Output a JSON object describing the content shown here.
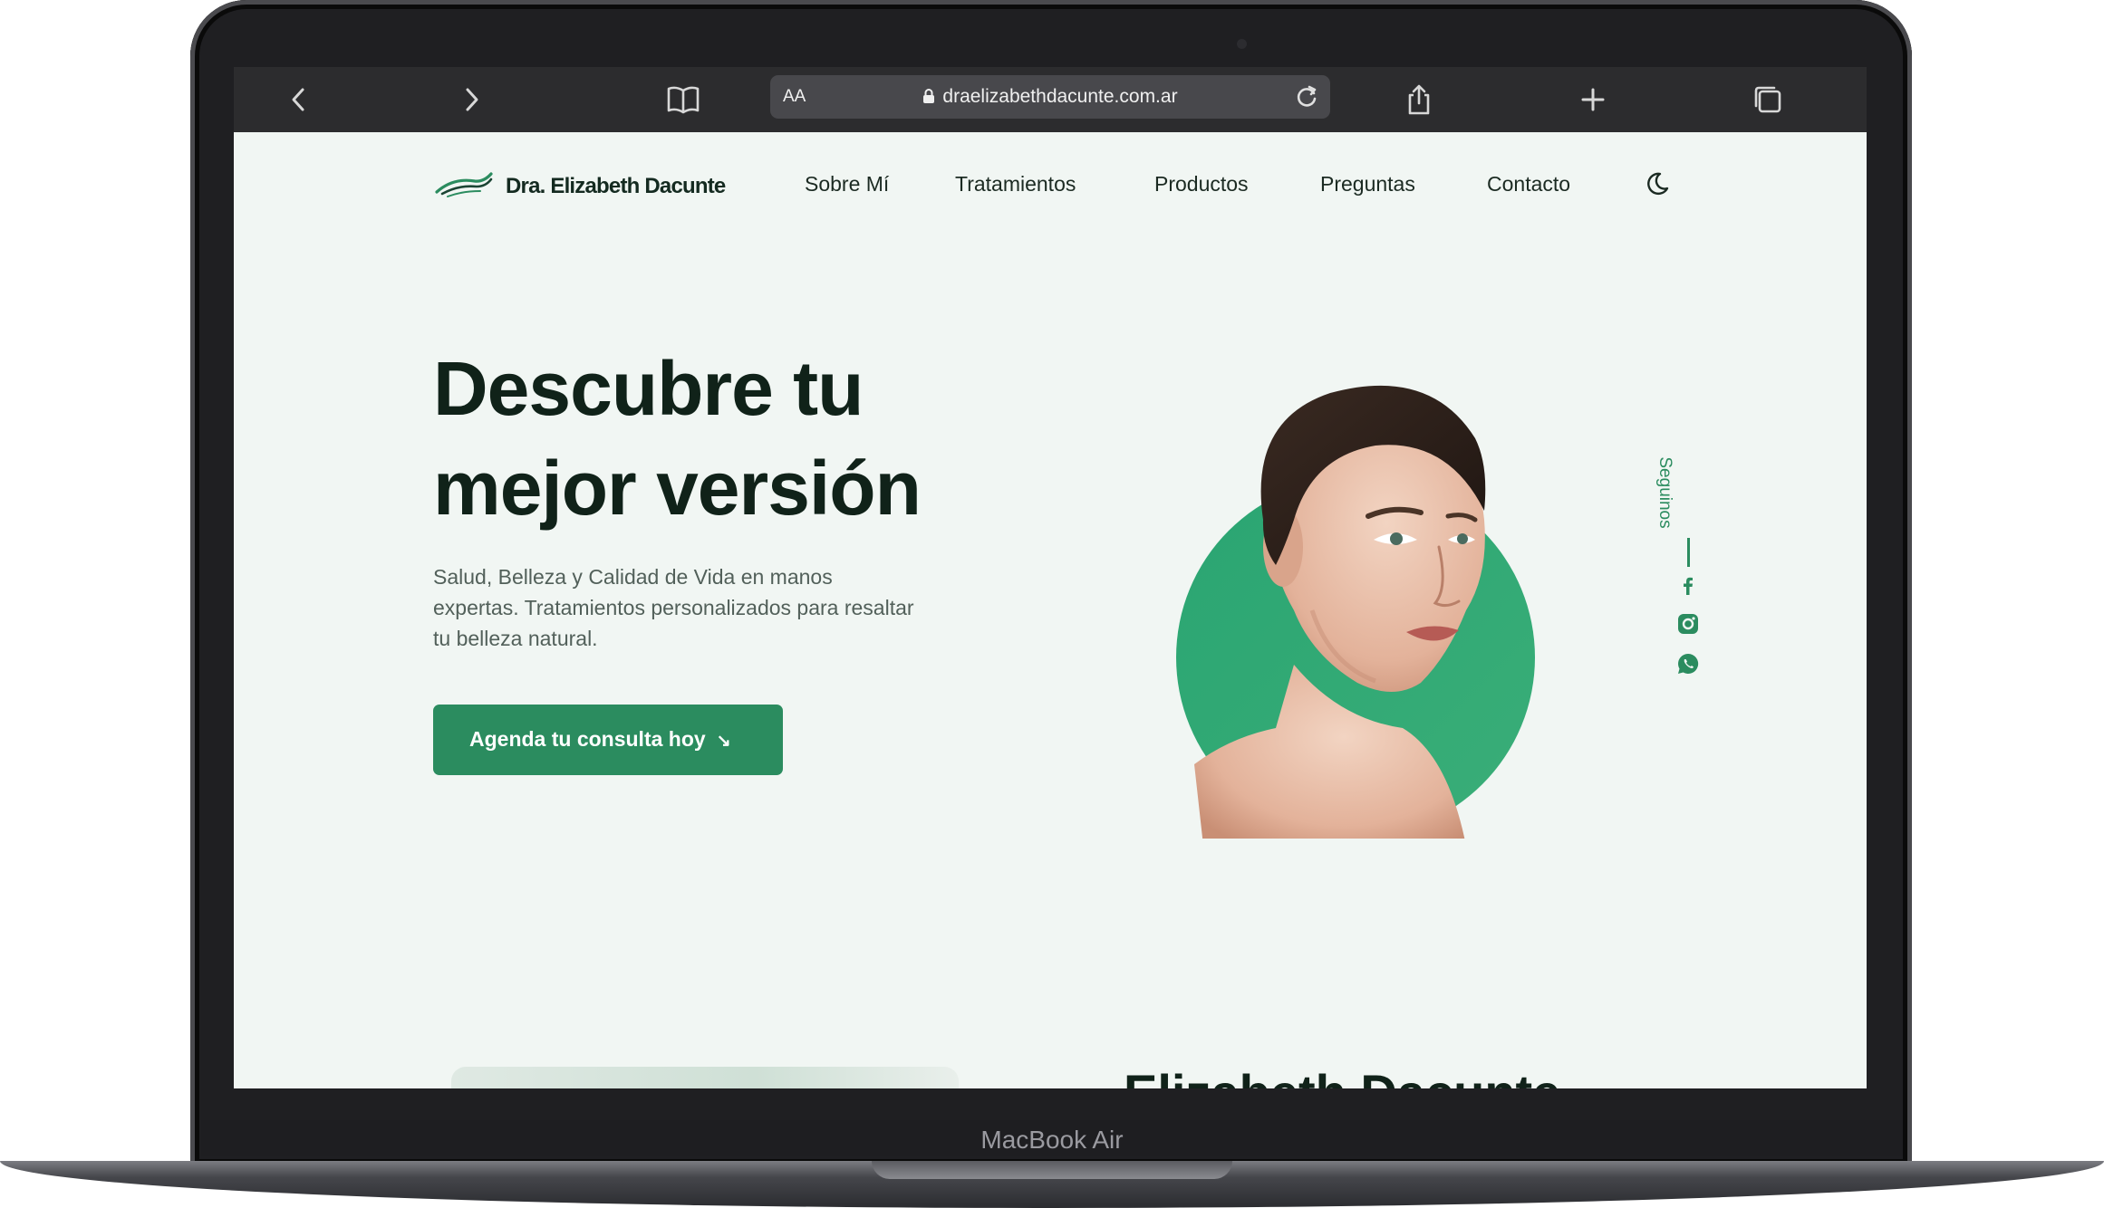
{
  "device": {
    "model_label": "MacBook Air"
  },
  "browser": {
    "aa_label": "AA",
    "url": "draelizabethdacunte.com.ar"
  },
  "site": {
    "brand": "Dra. Elizabeth Dacunte",
    "nav": [
      "Sobre Mí",
      "Tratamientos",
      "Productos",
      "Preguntas",
      "Contacto"
    ],
    "hero": {
      "title_line1": "Descubre tu",
      "title_line2": "mejor versión",
      "subtitle": "Salud, Belleza y Calidad de Vida en manos expertas. Tratamientos personalizados para resaltar tu belleza natural.",
      "cta_label": "Agenda tu consulta hoy",
      "cta_arrow": "↘"
    },
    "social": {
      "label": "Seguinos",
      "icons": [
        "facebook-icon",
        "instagram-icon",
        "whatsapp-icon"
      ]
    },
    "next_section_title": "Elizabeth Dacunte"
  },
  "colors": {
    "accent": "#2b8c5f",
    "page_bg": "#f1f6f3",
    "heading": "#102219",
    "toolbar": "#2c2c2e"
  }
}
